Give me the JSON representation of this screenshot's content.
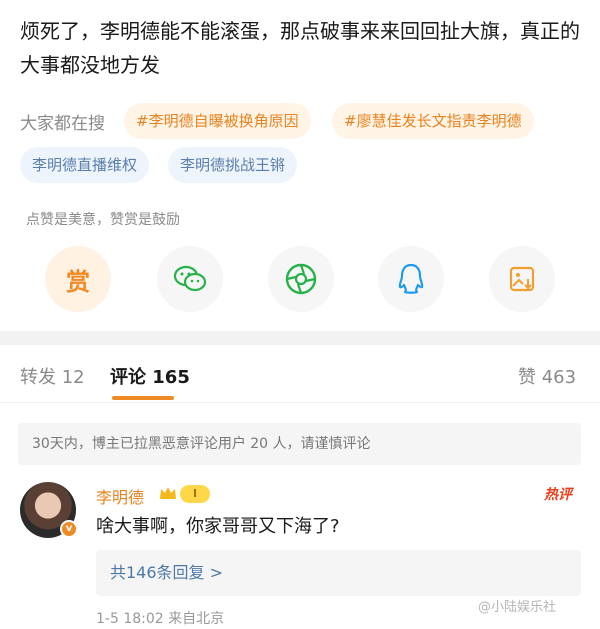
{
  "post": {
    "text": "烦死了，李明德能不能滚蛋，那点破事来来回回扯大旗，真正的大事都没地方发"
  },
  "search": {
    "label": "大家都在搜",
    "tags": [
      "#李明德自曝被换角原因",
      "#廖慧佳发长文指责李明德",
      "李明德直播维权",
      "李明德挑战王锵"
    ]
  },
  "reward": {
    "hint": "点赞是美意，赞赏是鼓励",
    "button_label": "赏"
  },
  "share_buttons": [
    "reward",
    "wechat",
    "moments",
    "qq",
    "save-image"
  ],
  "tabs": {
    "repost": "转发 12",
    "comments": "评论 165",
    "likes": "赞 463"
  },
  "notice": "30天内，博主已拉黑恶意评论用户 20 人，请谨慎评论",
  "comment": {
    "username": "李明德",
    "level": "I",
    "hot_label": "热评",
    "text": "啥大事啊，你家哥哥又下海了?",
    "replies": "共146条回复 >",
    "meta": "1-5 18:02 来自北京"
  },
  "watermark": "@小陆娱乐社",
  "colors": {
    "accent": "#f08a24",
    "link": "#4d78a8",
    "username": "#e8831f"
  }
}
